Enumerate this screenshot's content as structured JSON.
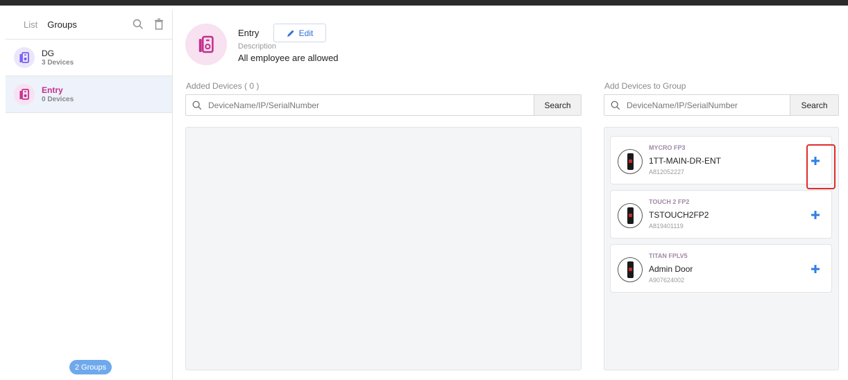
{
  "sidebar": {
    "tabs": [
      {
        "label": "List",
        "active": false
      },
      {
        "label": "Groups",
        "active": true
      }
    ],
    "groups": [
      {
        "name": "DG",
        "count": "3 Devices",
        "selected": false
      },
      {
        "name": "Entry",
        "count": "0 Devices",
        "selected": true
      }
    ],
    "footer_badge": "2 Groups"
  },
  "group_header": {
    "title": "Entry",
    "edit_label": "Edit",
    "description_label": "Description",
    "description_value": "All employee are allowed"
  },
  "added_devices": {
    "label": "Added Devices ( 0 )",
    "search_placeholder": "DeviceName/IP/SerialNumber",
    "search_button": "Search"
  },
  "add_devices": {
    "label": "Add Devices to Group",
    "search_placeholder": "DeviceName/IP/SerialNumber",
    "search_button": "Search",
    "devices": [
      {
        "model": "MYCRO FP3",
        "name": "1TT-MAIN-DR-ENT",
        "serial": "A812052227"
      },
      {
        "model": "TOUCH 2 FP2",
        "name": "TSTOUCH2FP2",
        "serial": "A819401119"
      },
      {
        "model": "TITAN FPLV5",
        "name": "Admin Door",
        "serial": "A907624002"
      }
    ]
  },
  "colors": {
    "accent_blue": "#2f6fdc",
    "group_pink": "#c2308e",
    "highlight_red": "#e12b2b"
  }
}
